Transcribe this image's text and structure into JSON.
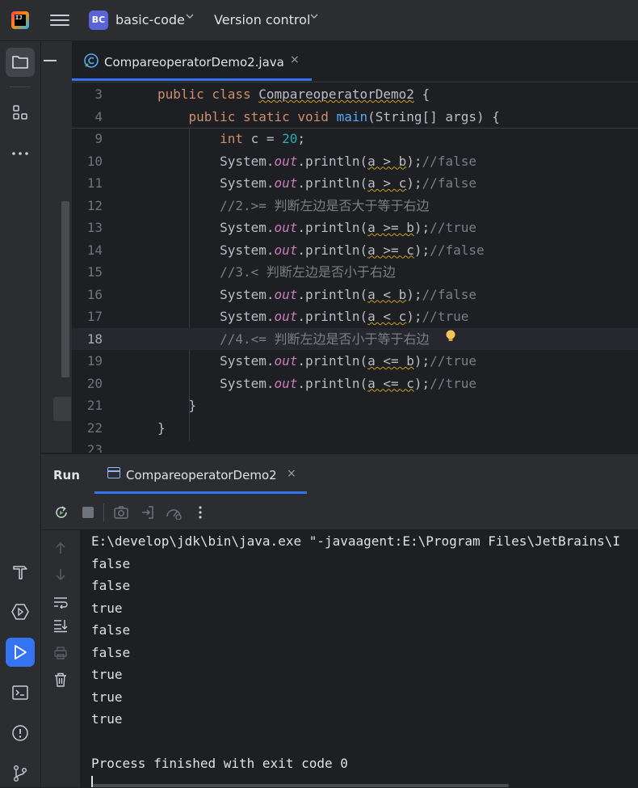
{
  "topbar": {
    "app_logo_text": "IJ",
    "project_badge": "BC",
    "project_name": "basic-code",
    "vcs_label": "Version control"
  },
  "left_strip": {
    "top_icons": [
      "folder-icon",
      "structure-icon",
      "more-icon"
    ],
    "bottom_icons": [
      "build-hammer-icon",
      "services-icon",
      "run-icon",
      "terminal-icon",
      "problems-icon",
      "git-icon"
    ]
  },
  "editor": {
    "tab_label": "CompareoperatorDemo2.java",
    "tab_close": "×",
    "lines": [
      {
        "n": "3",
        "parts": [
          [
            "kw",
            "public class "
          ],
          [
            "warn",
            "CompareoperatorDemo2"
          ],
          [
            "p",
            " {"
          ]
        ]
      },
      {
        "n": "4",
        "parts": [
          [
            "p",
            "    "
          ],
          [
            "kw",
            "public static void "
          ],
          [
            "fn",
            "main"
          ],
          [
            "p",
            "(String[] args) {"
          ]
        ]
      },
      {
        "n": "9",
        "parts": [
          [
            "p",
            "        "
          ],
          [
            "kw",
            "int "
          ],
          [
            "p",
            "c = "
          ],
          [
            "num",
            "20"
          ],
          [
            "p",
            ";"
          ]
        ]
      },
      {
        "n": "10",
        "parts": [
          [
            "p",
            "        System."
          ],
          [
            "fld",
            "out"
          ],
          [
            "p",
            ".println("
          ],
          [
            "warn",
            "a > b"
          ],
          [
            "p",
            ");"
          ],
          [
            "cmt",
            "//false"
          ]
        ]
      },
      {
        "n": "11",
        "parts": [
          [
            "p",
            "        System."
          ],
          [
            "fld",
            "out"
          ],
          [
            "p",
            ".println("
          ],
          [
            "warn",
            "a > c"
          ],
          [
            "p",
            ");"
          ],
          [
            "cmt",
            "//false"
          ]
        ]
      },
      {
        "n": "12",
        "parts": [
          [
            "p",
            "        "
          ],
          [
            "cmt",
            "//2.>= 判断左边是否大于等于右边"
          ]
        ]
      },
      {
        "n": "13",
        "parts": [
          [
            "p",
            "        System."
          ],
          [
            "fld",
            "out"
          ],
          [
            "p",
            ".println("
          ],
          [
            "warn",
            "a >= b"
          ],
          [
            "p",
            ");"
          ],
          [
            "cmt",
            "//true"
          ]
        ]
      },
      {
        "n": "14",
        "parts": [
          [
            "p",
            "        System."
          ],
          [
            "fld",
            "out"
          ],
          [
            "p",
            ".println("
          ],
          [
            "warn",
            "a >= c"
          ],
          [
            "p",
            ");"
          ],
          [
            "cmt",
            "//false"
          ]
        ]
      },
      {
        "n": "15",
        "parts": [
          [
            "p",
            "        "
          ],
          [
            "cmt",
            "//3.< 判断左边是否小于右边"
          ]
        ]
      },
      {
        "n": "16",
        "parts": [
          [
            "p",
            "        System."
          ],
          [
            "fld",
            "out"
          ],
          [
            "p",
            ".println("
          ],
          [
            "warn",
            "a < b"
          ],
          [
            "p",
            ");"
          ],
          [
            "cmt",
            "//false"
          ]
        ]
      },
      {
        "n": "17",
        "parts": [
          [
            "p",
            "        System."
          ],
          [
            "fld",
            "out"
          ],
          [
            "p",
            ".println("
          ],
          [
            "warn",
            "a < c"
          ],
          [
            "p",
            ");"
          ],
          [
            "cmt",
            "//true"
          ]
        ]
      },
      {
        "n": "18",
        "parts": [
          [
            "p",
            "        "
          ],
          [
            "cmt",
            "//4.<= 判断左边是否小于等于右边"
          ]
        ]
      },
      {
        "n": "19",
        "parts": [
          [
            "p",
            "        System."
          ],
          [
            "fld",
            "out"
          ],
          [
            "p",
            ".println("
          ],
          [
            "warn",
            "a <= b"
          ],
          [
            "p",
            ");"
          ],
          [
            "cmt",
            "//true"
          ]
        ]
      },
      {
        "n": "20",
        "parts": [
          [
            "p",
            "        System."
          ],
          [
            "fld",
            "out"
          ],
          [
            "p",
            ".println("
          ],
          [
            "warn",
            "a <= c"
          ],
          [
            "p",
            ");"
          ],
          [
            "cmt",
            "//true"
          ]
        ]
      },
      {
        "n": "21",
        "parts": [
          [
            "p",
            "    }"
          ]
        ]
      },
      {
        "n": "22",
        "parts": [
          [
            "p",
            "}"
          ]
        ]
      },
      {
        "n": "23",
        "parts": []
      }
    ],
    "current_line": "18"
  },
  "run": {
    "title": "Run",
    "tab_label": "CompareoperatorDemo2",
    "tab_close": "×",
    "toolbar_icons": [
      "rerun-icon",
      "stop-icon",
      "camera-icon",
      "exit-icon",
      "performance-icon",
      "more-vertical-icon"
    ],
    "gutter_icons": [
      "arrow-up-icon",
      "arrow-down-icon",
      "soft-wrap-icon",
      "scroll-to-end-icon",
      "print-icon",
      "trash-icon"
    ],
    "console_lines": [
      "E:\\develop\\jdk\\bin\\java.exe \"-javaagent:E:\\Program Files\\JetBrains\\I",
      "false",
      "false",
      "true",
      "false",
      "false",
      "true",
      "true",
      "true",
      "",
      "Process finished with exit code 0"
    ]
  }
}
